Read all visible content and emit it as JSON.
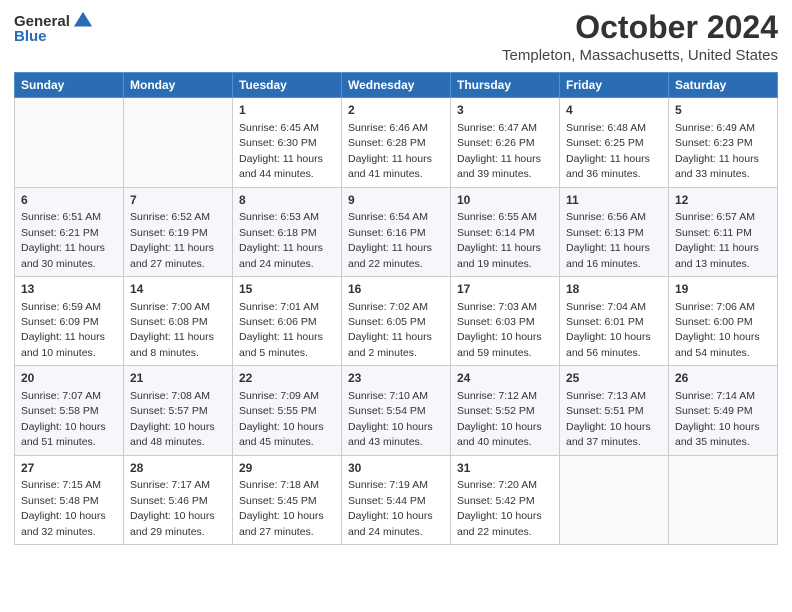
{
  "header": {
    "logo_general": "General",
    "logo_blue": "Blue",
    "title": "October 2024",
    "subtitle": "Templeton, Massachusetts, United States"
  },
  "columns": [
    "Sunday",
    "Monday",
    "Tuesday",
    "Wednesday",
    "Thursday",
    "Friday",
    "Saturday"
  ],
  "weeks": [
    [
      {
        "day": "",
        "info": ""
      },
      {
        "day": "",
        "info": ""
      },
      {
        "day": "1",
        "info": "Sunrise: 6:45 AM\nSunset: 6:30 PM\nDaylight: 11 hours and 44 minutes."
      },
      {
        "day": "2",
        "info": "Sunrise: 6:46 AM\nSunset: 6:28 PM\nDaylight: 11 hours and 41 minutes."
      },
      {
        "day": "3",
        "info": "Sunrise: 6:47 AM\nSunset: 6:26 PM\nDaylight: 11 hours and 39 minutes."
      },
      {
        "day": "4",
        "info": "Sunrise: 6:48 AM\nSunset: 6:25 PM\nDaylight: 11 hours and 36 minutes."
      },
      {
        "day": "5",
        "info": "Sunrise: 6:49 AM\nSunset: 6:23 PM\nDaylight: 11 hours and 33 minutes."
      }
    ],
    [
      {
        "day": "6",
        "info": "Sunrise: 6:51 AM\nSunset: 6:21 PM\nDaylight: 11 hours and 30 minutes."
      },
      {
        "day": "7",
        "info": "Sunrise: 6:52 AM\nSunset: 6:19 PM\nDaylight: 11 hours and 27 minutes."
      },
      {
        "day": "8",
        "info": "Sunrise: 6:53 AM\nSunset: 6:18 PM\nDaylight: 11 hours and 24 minutes."
      },
      {
        "day": "9",
        "info": "Sunrise: 6:54 AM\nSunset: 6:16 PM\nDaylight: 11 hours and 22 minutes."
      },
      {
        "day": "10",
        "info": "Sunrise: 6:55 AM\nSunset: 6:14 PM\nDaylight: 11 hours and 19 minutes."
      },
      {
        "day": "11",
        "info": "Sunrise: 6:56 AM\nSunset: 6:13 PM\nDaylight: 11 hours and 16 minutes."
      },
      {
        "day": "12",
        "info": "Sunrise: 6:57 AM\nSunset: 6:11 PM\nDaylight: 11 hours and 13 minutes."
      }
    ],
    [
      {
        "day": "13",
        "info": "Sunrise: 6:59 AM\nSunset: 6:09 PM\nDaylight: 11 hours and 10 minutes."
      },
      {
        "day": "14",
        "info": "Sunrise: 7:00 AM\nSunset: 6:08 PM\nDaylight: 11 hours and 8 minutes."
      },
      {
        "day": "15",
        "info": "Sunrise: 7:01 AM\nSunset: 6:06 PM\nDaylight: 11 hours and 5 minutes."
      },
      {
        "day": "16",
        "info": "Sunrise: 7:02 AM\nSunset: 6:05 PM\nDaylight: 11 hours and 2 minutes."
      },
      {
        "day": "17",
        "info": "Sunrise: 7:03 AM\nSunset: 6:03 PM\nDaylight: 10 hours and 59 minutes."
      },
      {
        "day": "18",
        "info": "Sunrise: 7:04 AM\nSunset: 6:01 PM\nDaylight: 10 hours and 56 minutes."
      },
      {
        "day": "19",
        "info": "Sunrise: 7:06 AM\nSunset: 6:00 PM\nDaylight: 10 hours and 54 minutes."
      }
    ],
    [
      {
        "day": "20",
        "info": "Sunrise: 7:07 AM\nSunset: 5:58 PM\nDaylight: 10 hours and 51 minutes."
      },
      {
        "day": "21",
        "info": "Sunrise: 7:08 AM\nSunset: 5:57 PM\nDaylight: 10 hours and 48 minutes."
      },
      {
        "day": "22",
        "info": "Sunrise: 7:09 AM\nSunset: 5:55 PM\nDaylight: 10 hours and 45 minutes."
      },
      {
        "day": "23",
        "info": "Sunrise: 7:10 AM\nSunset: 5:54 PM\nDaylight: 10 hours and 43 minutes."
      },
      {
        "day": "24",
        "info": "Sunrise: 7:12 AM\nSunset: 5:52 PM\nDaylight: 10 hours and 40 minutes."
      },
      {
        "day": "25",
        "info": "Sunrise: 7:13 AM\nSunset: 5:51 PM\nDaylight: 10 hours and 37 minutes."
      },
      {
        "day": "26",
        "info": "Sunrise: 7:14 AM\nSunset: 5:49 PM\nDaylight: 10 hours and 35 minutes."
      }
    ],
    [
      {
        "day": "27",
        "info": "Sunrise: 7:15 AM\nSunset: 5:48 PM\nDaylight: 10 hours and 32 minutes."
      },
      {
        "day": "28",
        "info": "Sunrise: 7:17 AM\nSunset: 5:46 PM\nDaylight: 10 hours and 29 minutes."
      },
      {
        "day": "29",
        "info": "Sunrise: 7:18 AM\nSunset: 5:45 PM\nDaylight: 10 hours and 27 minutes."
      },
      {
        "day": "30",
        "info": "Sunrise: 7:19 AM\nSunset: 5:44 PM\nDaylight: 10 hours and 24 minutes."
      },
      {
        "day": "31",
        "info": "Sunrise: 7:20 AM\nSunset: 5:42 PM\nDaylight: 10 hours and 22 minutes."
      },
      {
        "day": "",
        "info": ""
      },
      {
        "day": "",
        "info": ""
      }
    ]
  ]
}
